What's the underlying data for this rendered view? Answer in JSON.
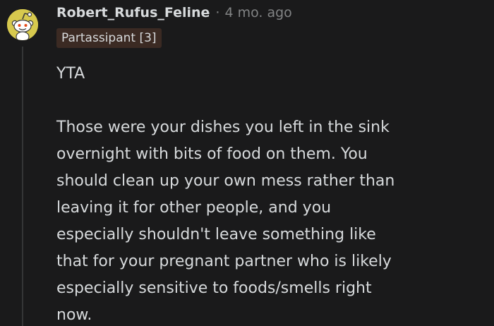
{
  "comment": {
    "author": "Robert_Rufus_Feline",
    "separator": "·",
    "timestamp": "4 mo. ago",
    "flair": "Partassipant [3]",
    "avatar_icon": "reddit-snoo-icon",
    "verdict": "YTA",
    "body_lines": [
      "Those were your dishes you left in the sink",
      "overnight with bits of food on them. You",
      "should clean up your own mess rather than",
      "leaving it for other people, and you",
      "especially shouldn't leave something like",
      "that for your pregnant partner who is likely",
      "especially sensitive to foods/smells right",
      "now."
    ]
  },
  "colors": {
    "background": "#1a1a1b",
    "text": "#d7dadc",
    "meta": "#818384",
    "flair_bg": "#3b2a23",
    "avatar_bg": "#d7c94e",
    "thread_line": "#343536"
  }
}
